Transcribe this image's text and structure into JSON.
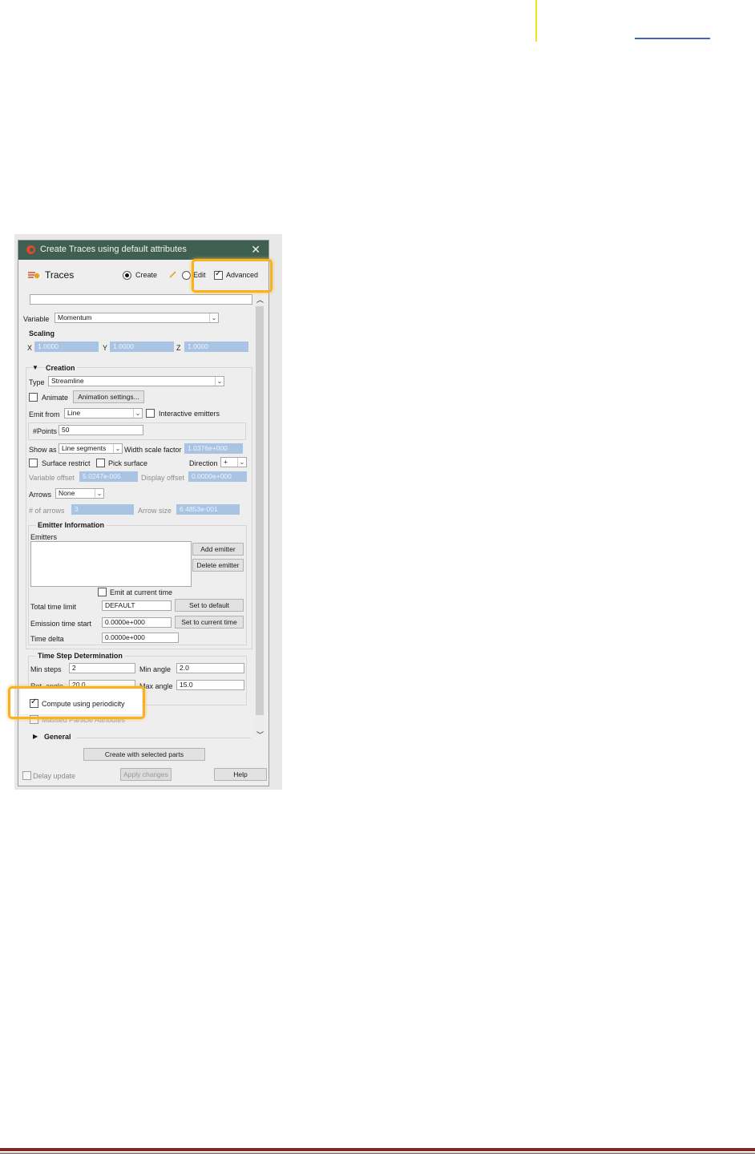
{
  "dialog": {
    "title": "Create Traces using default attributes",
    "close_glyph": "✕",
    "header": {
      "title": "Traces",
      "create_label": "Create",
      "edit_label": "Edit",
      "advanced_label": "Advanced"
    },
    "variable": {
      "label": "Variable",
      "value": "Momentum"
    },
    "scaling": {
      "heading": "Scaling",
      "x_label": "X",
      "x_value": "1.0000",
      "y_label": "Y",
      "y_value": "1.0000",
      "z_label": "Z",
      "z_value": "1.0000"
    },
    "creation": {
      "heading": "Creation",
      "type_label": "Type",
      "type_value": "Streamline",
      "animate_label": "Animate",
      "animation_settings_label": "Animation settings...",
      "emit_from_label": "Emit from",
      "emit_from_value": "Line",
      "interactive_emitters_label": "Interactive emitters",
      "points_label": "#Points",
      "points_value": "50",
      "show_as_label": "Show as",
      "show_as_value": "Line segments",
      "width_scale_label": "Width scale factor",
      "width_scale_value": "1.0376e+000",
      "surface_restrict_label": "Surface restrict",
      "pick_surface_label": "Pick surface",
      "direction_label": "Direction",
      "direction_value": "+",
      "variable_offset_label": "Variable offset",
      "variable_offset_value": "5.0247e-005",
      "display_offset_label": "Display offset",
      "display_offset_value": "0.0000e+000",
      "arrows_label": "Arrows",
      "arrows_value": "None",
      "num_arrows_label": "# of arrows",
      "num_arrows_value": "3",
      "arrow_size_label": "Arrow size",
      "arrow_size_value": "6.4853e-001"
    },
    "emitter_info": {
      "heading": "Emitter Information",
      "emitters_label": "Emitters",
      "add_emitter_label": "Add emitter",
      "delete_emitter_label": "Delete emitter",
      "emit_current_label": "Emit at current time",
      "total_time_label": "Total time limit",
      "total_time_value": "DEFAULT",
      "set_default_label": "Set to default",
      "emission_start_label": "Emission time start",
      "emission_start_value": "0.0000e+000",
      "set_current_label": "Set to current time",
      "time_delta_label": "Time delta",
      "time_delta_value": "0.0000e+000"
    },
    "time_step": {
      "heading": "Time Step Determination",
      "min_steps_label": "Min steps",
      "min_steps_value": "2",
      "min_angle_label": "Min angle",
      "min_angle_value": "2.0",
      "rot_angle_label": "Rot. angle",
      "rot_angle_value": "20.0",
      "max_angle_label": "Max angle",
      "max_angle_value": "15.0"
    },
    "compute_periodicity_label": "Compute using periodicity",
    "massed_particle_label": "Massed Particle Attributes",
    "general_heading": "General",
    "create_button_label": "Create with selected parts",
    "delay_update_label": "Delay update",
    "apply_changes_label": "Apply changes",
    "help_label": "Help"
  },
  "colors": {
    "highlight": "#f8b21d",
    "titlebar": "#3f5f52",
    "disabled_field": "#a9c3e3"
  }
}
